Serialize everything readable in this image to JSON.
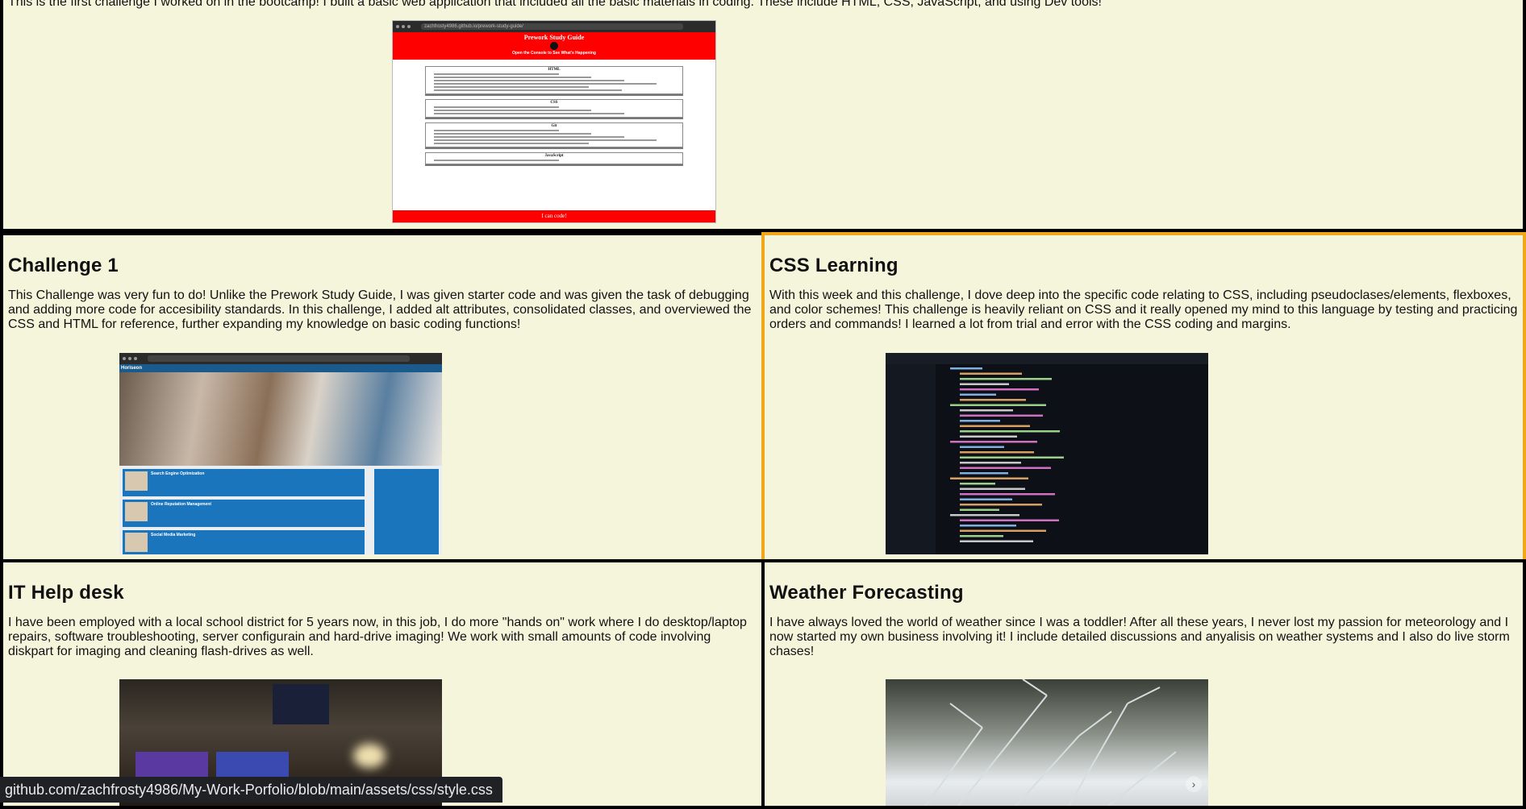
{
  "top_card": {
    "description": "This is the first challenge I worked on in the bootcamp! I built a basic web application that included all the basic materials in coding. These include HTML, CSS, JavaScript, and using Dev tools!",
    "screenshot": {
      "url": "zachfrosty4986.github.io/prework-study-guide/",
      "title": "Prework Study Guide",
      "subtitle": "Open the Console to See What's Happening",
      "sections": [
        "HTML",
        "CSS",
        "Git",
        "JavaScript"
      ],
      "footer": "I can code!"
    }
  },
  "cards": [
    {
      "title": "Challenge 1",
      "description": "This Challenge was very fun to do! Unlike the Prework Study Guide, I was given starter code and was given the task of debugging and adding more code for accesibility standards. In this challenge, I added alt attributes, consolidated classes, and overviewed the CSS and HTML for reference, further expanding my knowledge on basic coding functions!",
      "screenshot": {
        "brand": "Horiseon",
        "rows": [
          "Search Engine Optimization",
          "Online Reputation Management",
          "Social Media Marketing"
        ]
      }
    },
    {
      "title": "CSS Learning",
      "description": "With this week and this challenge, I dove deep into the specific code relating to CSS, including pseudoclases/elements, flexboxes, and color schemes! This challenge is heavily reliant on CSS and it really opened my mind to this language by testing and practicing orders and commands! I learned a lot from trial and error with the CSS coding and margins."
    },
    {
      "title": "IT Help desk",
      "description": "I have been employed with a local school district for 5 years now, in this job, I do more \"hands on\" work where I do desktop/laptop repairs, software troubleshooting, server configurain and hard-drive imaging! We work with small amounts of code involving diskpart for imaging and cleaning flash-drives as well."
    },
    {
      "title": "Weather Forecasting",
      "description": "I have always loved the world of weather since I was a toddler! After all these years, I never lost my passion for meteorology and I now started my own business involving it! I include detailed discussions and anyalisis on weather systems and I also do live storm chases!"
    }
  ],
  "status_bar": {
    "url": "github.com/zachfrosty4986/My-Work-Porfolio/blob/main/assets/css/style.css"
  },
  "colors": {
    "background": "#f5f5dc",
    "border": "#000000",
    "hover_border": "#f0a818",
    "prework_red": "#ff0000",
    "horiseon_blue": "#1b75bc"
  }
}
